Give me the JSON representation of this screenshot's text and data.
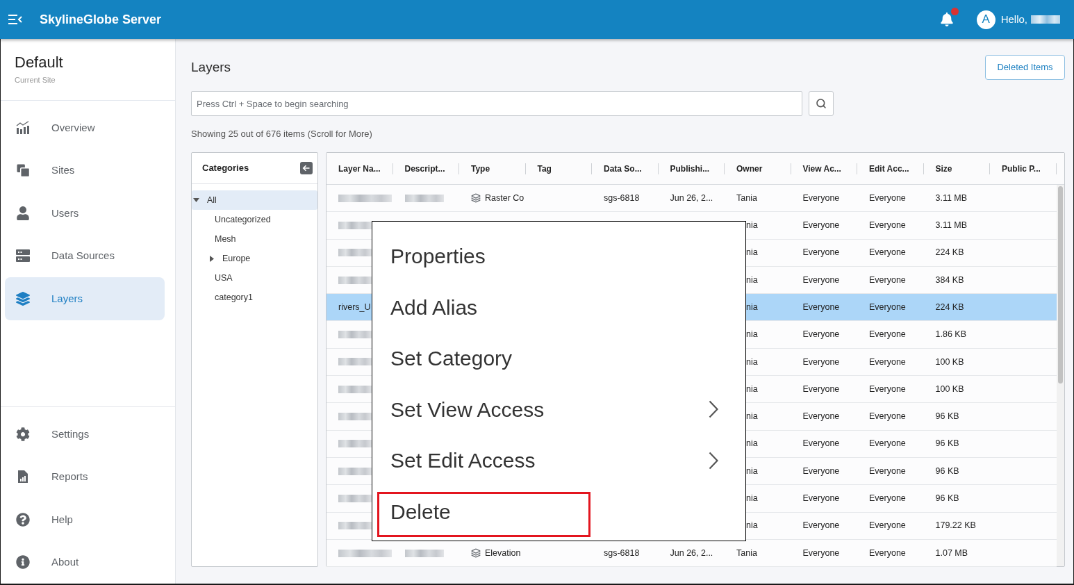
{
  "header": {
    "title": "SkylineGlobe Server",
    "notification_badge": true,
    "avatar_letter": "A",
    "greeting": "Hello,",
    "user_name_blurred": true
  },
  "sidebar": {
    "site_name": "Default",
    "site_caption": "Current Site",
    "items": [
      {
        "label": "Overview",
        "selected": false
      },
      {
        "label": "Sites",
        "selected": false
      },
      {
        "label": "Users",
        "selected": false
      },
      {
        "label": "Data Sources",
        "selected": false
      },
      {
        "label": "Layers",
        "selected": true
      }
    ],
    "footer_items": [
      {
        "label": "Settings",
        "selected": false
      },
      {
        "label": "Reports",
        "selected": false
      },
      {
        "label": "Help",
        "selected": false
      },
      {
        "label": "About",
        "selected": false
      }
    ]
  },
  "page": {
    "title": "Layers",
    "deleted_items_button": "Deleted Items",
    "search": {
      "placeholder": "Press Ctrl + Space to begin searching"
    },
    "status": "Showing 25 out of 676 items (Scroll for More)"
  },
  "categories": {
    "title": "Categories",
    "tree": [
      {
        "label": "All",
        "selected": true,
        "expanded": true,
        "children": [
          {
            "label": "Uncategorized",
            "selected": false
          },
          {
            "label": "Mesh",
            "selected": false
          },
          {
            "label": "Europe",
            "selected": false,
            "expanded": false
          },
          {
            "label": "USA",
            "selected": false
          },
          {
            "label": "category1",
            "selected": false
          }
        ]
      }
    ]
  },
  "table": {
    "columns": [
      "Layer Na...",
      "Descript...",
      "Type",
      "Tag",
      "Data So...",
      "Publishi...",
      "Owner",
      "View Ac...",
      "Edit Acc...",
      "Size",
      "Public P..."
    ],
    "rows": [
      {
        "layer_name_blurred": true,
        "description_blurred": true,
        "type": "Raster Co",
        "data_source": "sgs-6818",
        "published": "Jun 26, 2...",
        "owner": "Tania",
        "under_menu": false,
        "view_access": "Everyone",
        "edit_access": "Everyone",
        "size": "3.11 MB",
        "selected": false
      },
      {
        "layer_name_blurred": true,
        "owner": "nia",
        "under_menu": true,
        "view_access": "Everyone",
        "edit_access": "Everyone",
        "size": "3.11 MB",
        "selected": false
      },
      {
        "layer_name_blurred": true,
        "owner": "nia",
        "under_menu": true,
        "view_access": "Everyone",
        "edit_access": "Everyone",
        "size": "224 KB",
        "selected": false
      },
      {
        "layer_name_blurred": true,
        "owner": "nia",
        "under_menu": true,
        "view_access": "Everyone",
        "edit_access": "Everyone",
        "size": "384 KB",
        "selected": false
      },
      {
        "layer_name": "rivers_U",
        "layer_name_blurred": false,
        "owner": "nia",
        "under_menu": true,
        "view_access": "Everyone",
        "edit_access": "Everyone",
        "size": "224 KB",
        "selected": true
      },
      {
        "layer_name_blurred": true,
        "owner": "nia",
        "under_menu": true,
        "view_access": "Everyone",
        "edit_access": "Everyone",
        "size": "1.86 KB",
        "selected": false
      },
      {
        "layer_name_blurred": true,
        "owner": "nia",
        "under_menu": true,
        "view_access": "Everyone",
        "edit_access": "Everyone",
        "size": "100 KB",
        "selected": false
      },
      {
        "layer_name_blurred": true,
        "owner": "nia",
        "under_menu": true,
        "view_access": "Everyone",
        "edit_access": "Everyone",
        "size": "100 KB",
        "selected": false
      },
      {
        "layer_name_blurred": true,
        "owner": "nia",
        "under_menu": true,
        "view_access": "Everyone",
        "edit_access": "Everyone",
        "size": "96 KB",
        "selected": false
      },
      {
        "layer_name_blurred": true,
        "owner": "nia",
        "under_menu": true,
        "view_access": "Everyone",
        "edit_access": "Everyone",
        "size": "96 KB",
        "selected": false
      },
      {
        "layer_name_blurred": true,
        "owner": "nia",
        "under_menu": true,
        "view_access": "Everyone",
        "edit_access": "Everyone",
        "size": "96 KB",
        "selected": false
      },
      {
        "layer_name_blurred": true,
        "owner": "nia",
        "under_menu": true,
        "view_access": "Everyone",
        "edit_access": "Everyone",
        "size": "96 KB",
        "selected": false
      },
      {
        "layer_name_blurred": true,
        "owner": "nia",
        "under_menu": true,
        "view_access": "Everyone",
        "edit_access": "Everyone",
        "size": "179.22 KB",
        "selected": false
      },
      {
        "layer_name_blurred": true,
        "description_blurred": true,
        "type": "Elevation",
        "data_source": "sgs-6818",
        "published": "Jun 26, 2...",
        "owner": "Tania",
        "under_menu": false,
        "view_access": "Everyone",
        "edit_access": "Everyone",
        "size": "1.07 MB",
        "selected": false
      }
    ]
  },
  "context_menu": {
    "items": [
      {
        "label": "Properties",
        "submenu": false,
        "highlighted": false
      },
      {
        "label": "Add Alias",
        "submenu": false,
        "highlighted": false
      },
      {
        "label": "Set Category",
        "submenu": false,
        "highlighted": false
      },
      {
        "label": "Set View Access",
        "submenu": true,
        "highlighted": false
      },
      {
        "label": "Set Edit Access",
        "submenu": true,
        "highlighted": false
      },
      {
        "label": "Delete",
        "submenu": false,
        "highlighted": true
      }
    ]
  }
}
